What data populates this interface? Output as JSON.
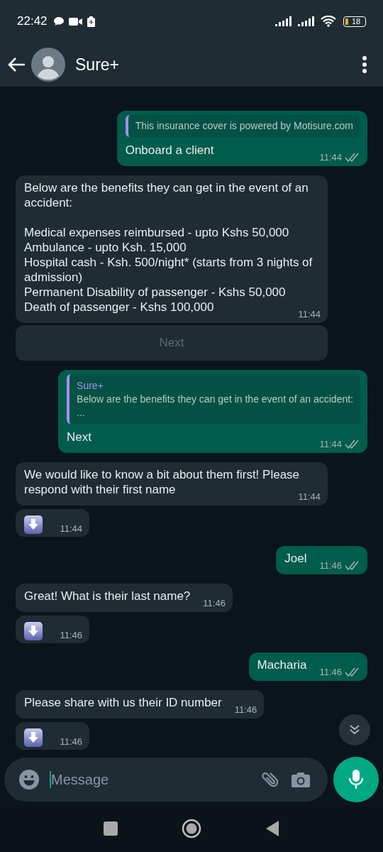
{
  "status_bar": {
    "time": "22:42",
    "battery": "18"
  },
  "header": {
    "title": "Sure+"
  },
  "messages": [
    {
      "kind": "quoted",
      "outgoing": true,
      "quote_text": "This insurance cover is powered by Motisure.com",
      "text": "Onboard a client",
      "time": "11:44"
    },
    {
      "kind": "text",
      "outgoing": false,
      "text": "Below are the benefits they can get in the event of an accident:\n\nMedical expenses reimbursed - upto Kshs 50,000\nAmbulance - upto Ksh. 15,000\nHospital cash - Ksh. 500/night* (starts from 3 nights of admission)\nPermanent Disability of  passenger - Kshs 50,000\nDeath of passenger - Kshs 100,000",
      "time": "11:44"
    },
    {
      "kind": "reply_button",
      "outgoing": false,
      "label": "Next",
      "disabled": true
    },
    {
      "kind": "quoted",
      "outgoing": true,
      "quote_sender": "Sure+",
      "quote_text": "Below are the benefits they can get in the event of an accident:\n...",
      "text": "Next",
      "time": "11:44"
    },
    {
      "kind": "text",
      "outgoing": false,
      "text": "We would like to know a bit about them first! Please respond with their first name",
      "time": "11:44"
    },
    {
      "kind": "download",
      "outgoing": false,
      "time": "11:44"
    },
    {
      "kind": "text",
      "outgoing": true,
      "text": "Joel",
      "time": "11:46"
    },
    {
      "kind": "text",
      "outgoing": false,
      "text": "Great! What is their last name?",
      "time": "11:46"
    },
    {
      "kind": "download",
      "outgoing": false,
      "time": "11:46"
    },
    {
      "kind": "text",
      "outgoing": true,
      "text": "Macharia",
      "time": "11:46"
    },
    {
      "kind": "text",
      "outgoing": false,
      "text": "Please share with us their ID number",
      "time": "11:46"
    },
    {
      "kind": "download",
      "outgoing": false,
      "time": "11:46"
    }
  ],
  "composer": {
    "placeholder": "Message"
  }
}
